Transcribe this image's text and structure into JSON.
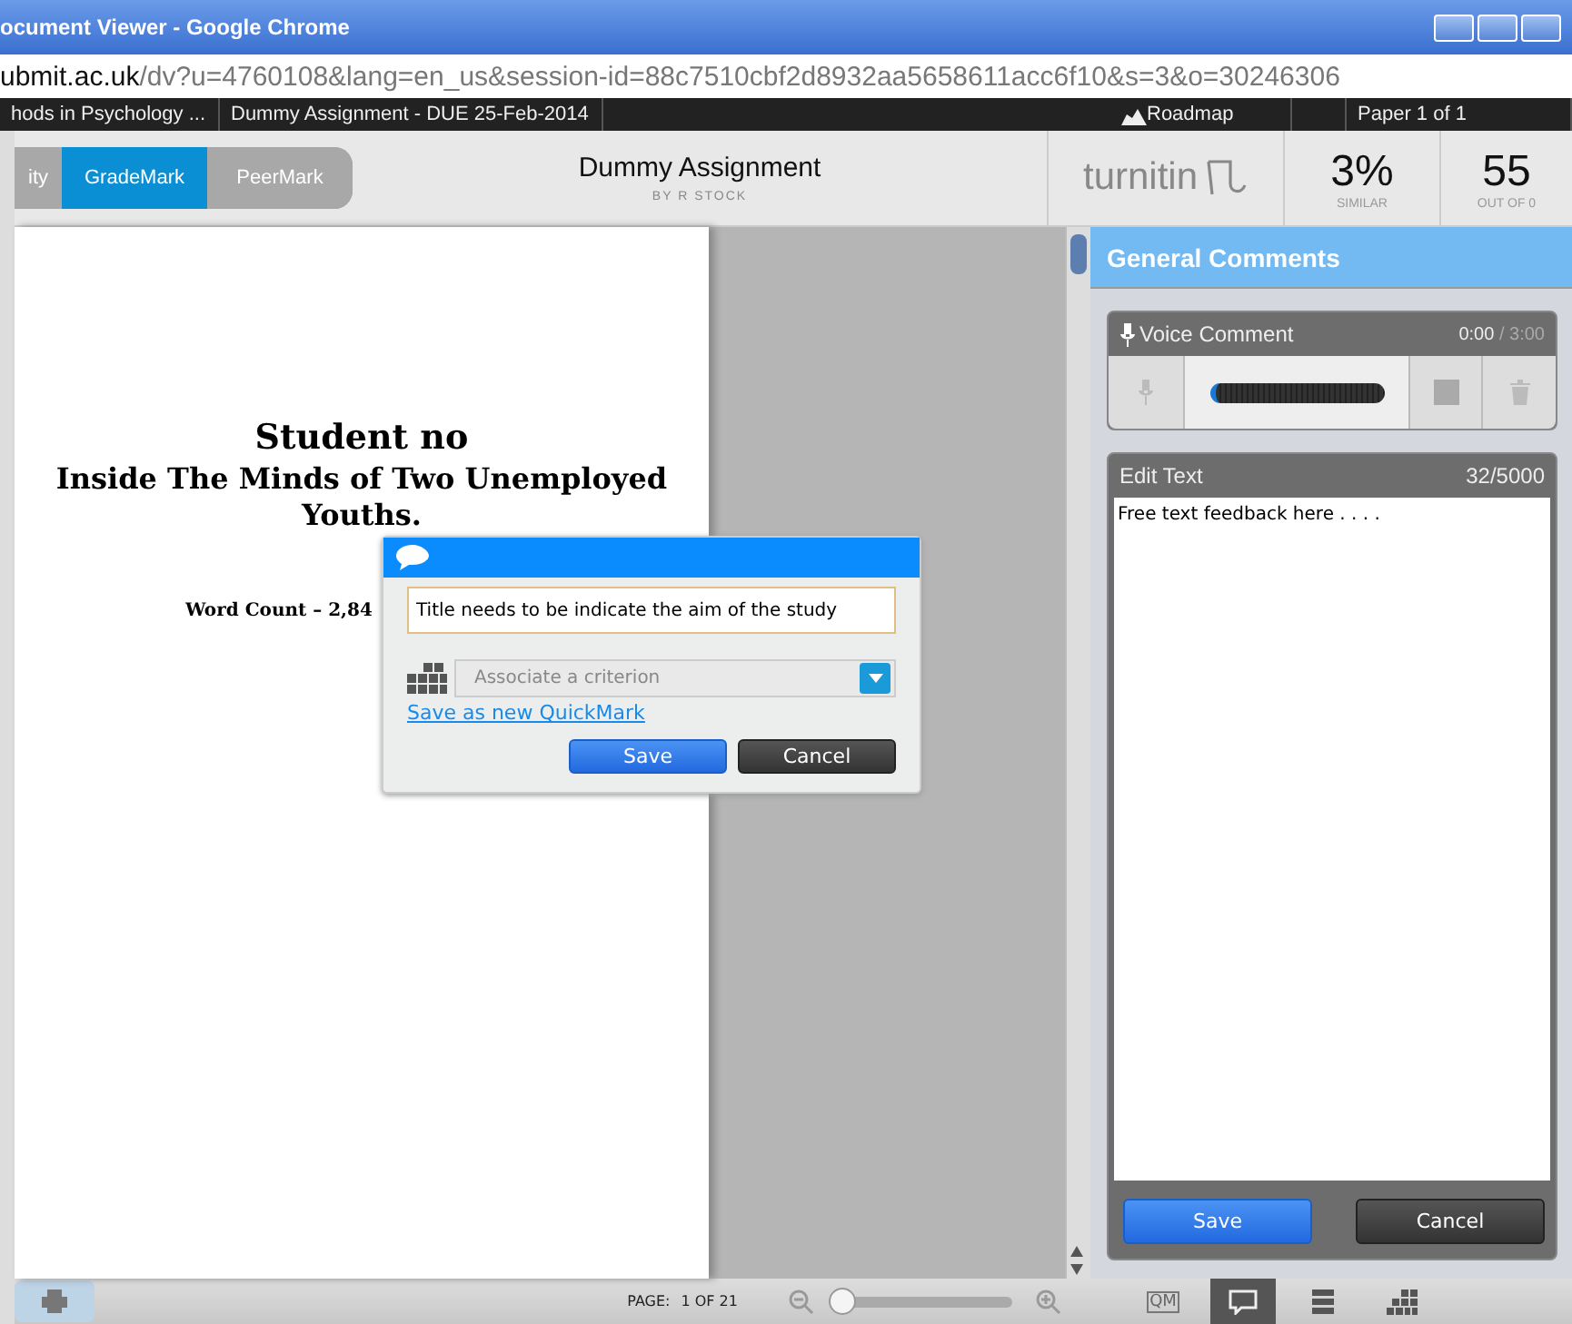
{
  "window": {
    "title": "ocument Viewer - Google Chrome"
  },
  "address": {
    "host": "ubmit.ac.uk",
    "path": "/dv?u=4760108&lang=en_us&session-id=88c7510cbf2d8932aa5658611acc6f10&s=3&o=30246306"
  },
  "class_bar": {
    "class_name": "hods in Psychology ...",
    "assignment": "Dummy Assignment - DUE 25-Feb-2014",
    "roadmap": "Roadmap",
    "paper": "Paper 1 of 1"
  },
  "modes": [
    {
      "label": "ity",
      "selected": false
    },
    {
      "label": "GradeMark",
      "selected": true
    },
    {
      "label": "PeerMark",
      "selected": false
    }
  ],
  "paper_header": {
    "title": "Dummy Assignment",
    "author": "BY R STOCK",
    "brand": "turnitin",
    "similarity": "3%",
    "similarity_label": "SIMILAR",
    "score": "55",
    "score_label": "OUT OF 0"
  },
  "document": {
    "lines": [
      "Student no",
      "Inside The Minds of Two Unemployed Youths."
    ],
    "word_count": "Word Count – 2,84"
  },
  "comment_popup": {
    "value": "Title needs to be indicate the aim of the study",
    "criterion_placeholder": "Associate a criterion",
    "quickmark_link": "Save as new QuickMark",
    "buttons": [
      "Save",
      "Cancel"
    ]
  },
  "general_comments": {
    "title": "General Comments",
    "voice": {
      "label": "Voice Comment",
      "elapsed": "0:00",
      "total": "/ 3:00"
    },
    "edit": {
      "label": "Edit Text",
      "count": "32/5000",
      "value": "Free text feedback here . . . ."
    },
    "buttons": [
      "Save",
      "Cancel"
    ]
  },
  "footer": {
    "page_label": "PAGE:",
    "page": "1 OF 21",
    "zoom": {
      "level": 0.02
    }
  },
  "side_tools": [
    {
      "kind": "quickmark",
      "label": "QM",
      "selected": false
    },
    {
      "kind": "comment",
      "selected": true
    },
    {
      "kind": "list",
      "selected": false
    },
    {
      "kind": "grid",
      "selected": false
    }
  ]
}
